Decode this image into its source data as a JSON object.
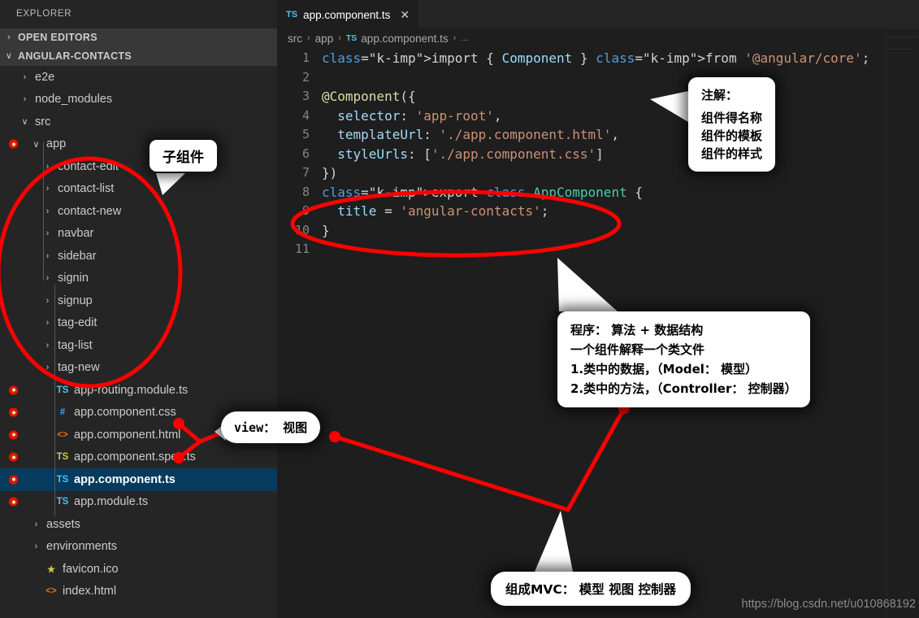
{
  "sidebar": {
    "header": "EXPLORER",
    "sections": [
      {
        "label": "OPEN EDITORS",
        "twisty": "›"
      },
      {
        "label": "ANGULAR-CONTACTS",
        "twisty": "∨"
      }
    ],
    "tree": [
      {
        "label": "e2e",
        "indent": 1,
        "twisty": "›",
        "icon": "",
        "iconColor": "",
        "error": false,
        "selected": false,
        "icon_name": "folder-collapsed-icon"
      },
      {
        "label": "node_modules",
        "indent": 1,
        "twisty": "›",
        "icon": "",
        "iconColor": "",
        "error": false,
        "selected": false,
        "icon_name": "folder-collapsed-icon"
      },
      {
        "label": "src",
        "indent": 1,
        "twisty": "∨",
        "icon": "",
        "iconColor": "",
        "error": false,
        "selected": false,
        "icon_name": "folder-expanded-icon"
      },
      {
        "label": "app",
        "indent": 2,
        "twisty": "∨",
        "icon": "",
        "iconColor": "",
        "error": true,
        "selected": false,
        "icon_name": "folder-expanded-icon"
      },
      {
        "label": "contact-edit",
        "indent": 3,
        "twisty": "›",
        "icon": "",
        "iconColor": "",
        "error": false,
        "selected": false,
        "icon_name": "folder-collapsed-icon"
      },
      {
        "label": "contact-list",
        "indent": 3,
        "twisty": "›",
        "icon": "",
        "iconColor": "",
        "error": false,
        "selected": false,
        "icon_name": "folder-collapsed-icon"
      },
      {
        "label": "contact-new",
        "indent": 3,
        "twisty": "›",
        "icon": "",
        "iconColor": "",
        "error": false,
        "selected": false,
        "icon_name": "folder-collapsed-icon"
      },
      {
        "label": "navbar",
        "indent": 3,
        "twisty": "›",
        "icon": "",
        "iconColor": "",
        "error": false,
        "selected": false,
        "icon_name": "folder-collapsed-icon"
      },
      {
        "label": "sidebar",
        "indent": 3,
        "twisty": "›",
        "icon": "",
        "iconColor": "",
        "error": false,
        "selected": false,
        "icon_name": "folder-collapsed-icon"
      },
      {
        "label": "signin",
        "indent": 3,
        "twisty": "›",
        "icon": "",
        "iconColor": "",
        "error": false,
        "selected": false,
        "icon_name": "folder-collapsed-icon"
      },
      {
        "label": "signup",
        "indent": 3,
        "twisty": "›",
        "icon": "",
        "iconColor": "",
        "error": false,
        "selected": false,
        "icon_name": "folder-collapsed-icon"
      },
      {
        "label": "tag-edit",
        "indent": 3,
        "twisty": "›",
        "icon": "",
        "iconColor": "",
        "error": false,
        "selected": false,
        "icon_name": "folder-collapsed-icon"
      },
      {
        "label": "tag-list",
        "indent": 3,
        "twisty": "›",
        "icon": "",
        "iconColor": "",
        "error": false,
        "selected": false,
        "icon_name": "folder-collapsed-icon"
      },
      {
        "label": "tag-new",
        "indent": 3,
        "twisty": "›",
        "icon": "",
        "iconColor": "",
        "error": false,
        "selected": false,
        "icon_name": "folder-collapsed-icon"
      },
      {
        "label": "app-routing.module.ts",
        "indent": 3,
        "twisty": "",
        "icon": "TS",
        "iconColor": "#4ec0f7",
        "error": true,
        "selected": false,
        "icon_name": "typescript-file-icon"
      },
      {
        "label": "app.component.css",
        "indent": 3,
        "twisty": "",
        "icon": "#",
        "iconColor": "#42a5f5",
        "error": true,
        "selected": false,
        "icon_name": "css-file-icon"
      },
      {
        "label": "app.component.html",
        "indent": 3,
        "twisty": "",
        "icon": "<>",
        "iconColor": "#e8690b",
        "error": true,
        "selected": false,
        "icon_name": "html-file-icon"
      },
      {
        "label": "app.component.spec.ts",
        "indent": 3,
        "twisty": "",
        "icon": "TS",
        "iconColor": "#cbcb41",
        "error": true,
        "selected": false,
        "icon_name": "typescript-spec-file-icon"
      },
      {
        "label": "app.component.ts",
        "indent": 3,
        "twisty": "",
        "icon": "TS",
        "iconColor": "#4ec0f7",
        "error": true,
        "selected": true,
        "icon_name": "typescript-file-icon"
      },
      {
        "label": "app.module.ts",
        "indent": 3,
        "twisty": "",
        "icon": "TS",
        "iconColor": "#4ec0f7",
        "error": true,
        "selected": false,
        "icon_name": "typescript-file-icon"
      },
      {
        "label": "assets",
        "indent": 2,
        "twisty": "›",
        "icon": "",
        "iconColor": "",
        "error": false,
        "selected": false,
        "icon_name": "folder-collapsed-icon"
      },
      {
        "label": "environments",
        "indent": 2,
        "twisty": "›",
        "icon": "",
        "iconColor": "",
        "error": false,
        "selected": false,
        "icon_name": "folder-collapsed-icon"
      },
      {
        "label": "favicon.ico",
        "indent": 2,
        "twisty": "",
        "icon": "★",
        "iconColor": "#cbcb41",
        "error": false,
        "selected": false,
        "icon_name": "favicon-file-icon"
      },
      {
        "label": "index.html",
        "indent": 2,
        "twisty": "",
        "icon": "<>",
        "iconColor": "#e8690b",
        "error": false,
        "selected": false,
        "icon_name": "html-file-icon"
      }
    ]
  },
  "editor": {
    "tab": {
      "badge": "TS",
      "name": "app.component.ts",
      "close": "✕"
    },
    "breadcrumb": {
      "p1": "src",
      "p2": "app",
      "badge": "TS",
      "p3": "app.component.ts",
      "dots": "..."
    },
    "lines": [
      {
        "n": "1",
        "text": "import { Component } from '@angular/core';"
      },
      {
        "n": "2",
        "text": ""
      },
      {
        "n": "3",
        "text": "@Component({"
      },
      {
        "n": "4",
        "text": "  selector: 'app-root',"
      },
      {
        "n": "5",
        "text": "  templateUrl: './app.component.html',"
      },
      {
        "n": "6",
        "text": "  styleUrls: ['./app.component.css']"
      },
      {
        "n": "7",
        "text": "})"
      },
      {
        "n": "8",
        "text": "export class AppComponent {"
      },
      {
        "n": "9",
        "text": "  title = 'angular-contacts';"
      },
      {
        "n": "10",
        "text": "}"
      },
      {
        "n": "11",
        "text": ""
      }
    ]
  },
  "annotations": {
    "child_component": "子组件",
    "decorator_title": "注解：",
    "decorator_l1": "组件得名称",
    "decorator_l2": "组件的模板",
    "decorator_l3": "组件的样式",
    "view": "view： 视图",
    "program_l1": "程序： 算法 + 数据结构",
    "program_l2": "一个组件解释一个类文件",
    "program_l3": "1.类中的数据，（Model： 模型）",
    "program_l4": "2.类中的方法，（Controller： 控制器）",
    "mvc": "组成MVC： 模型 视图 控制器"
  },
  "watermark": "https://blog.csdn.net/u010868192",
  "colors": {
    "accent_red": "#ff0000",
    "sidebar_bg": "#252526",
    "editor_bg": "#1e1e1e",
    "selection_bg": "#063b5e"
  }
}
